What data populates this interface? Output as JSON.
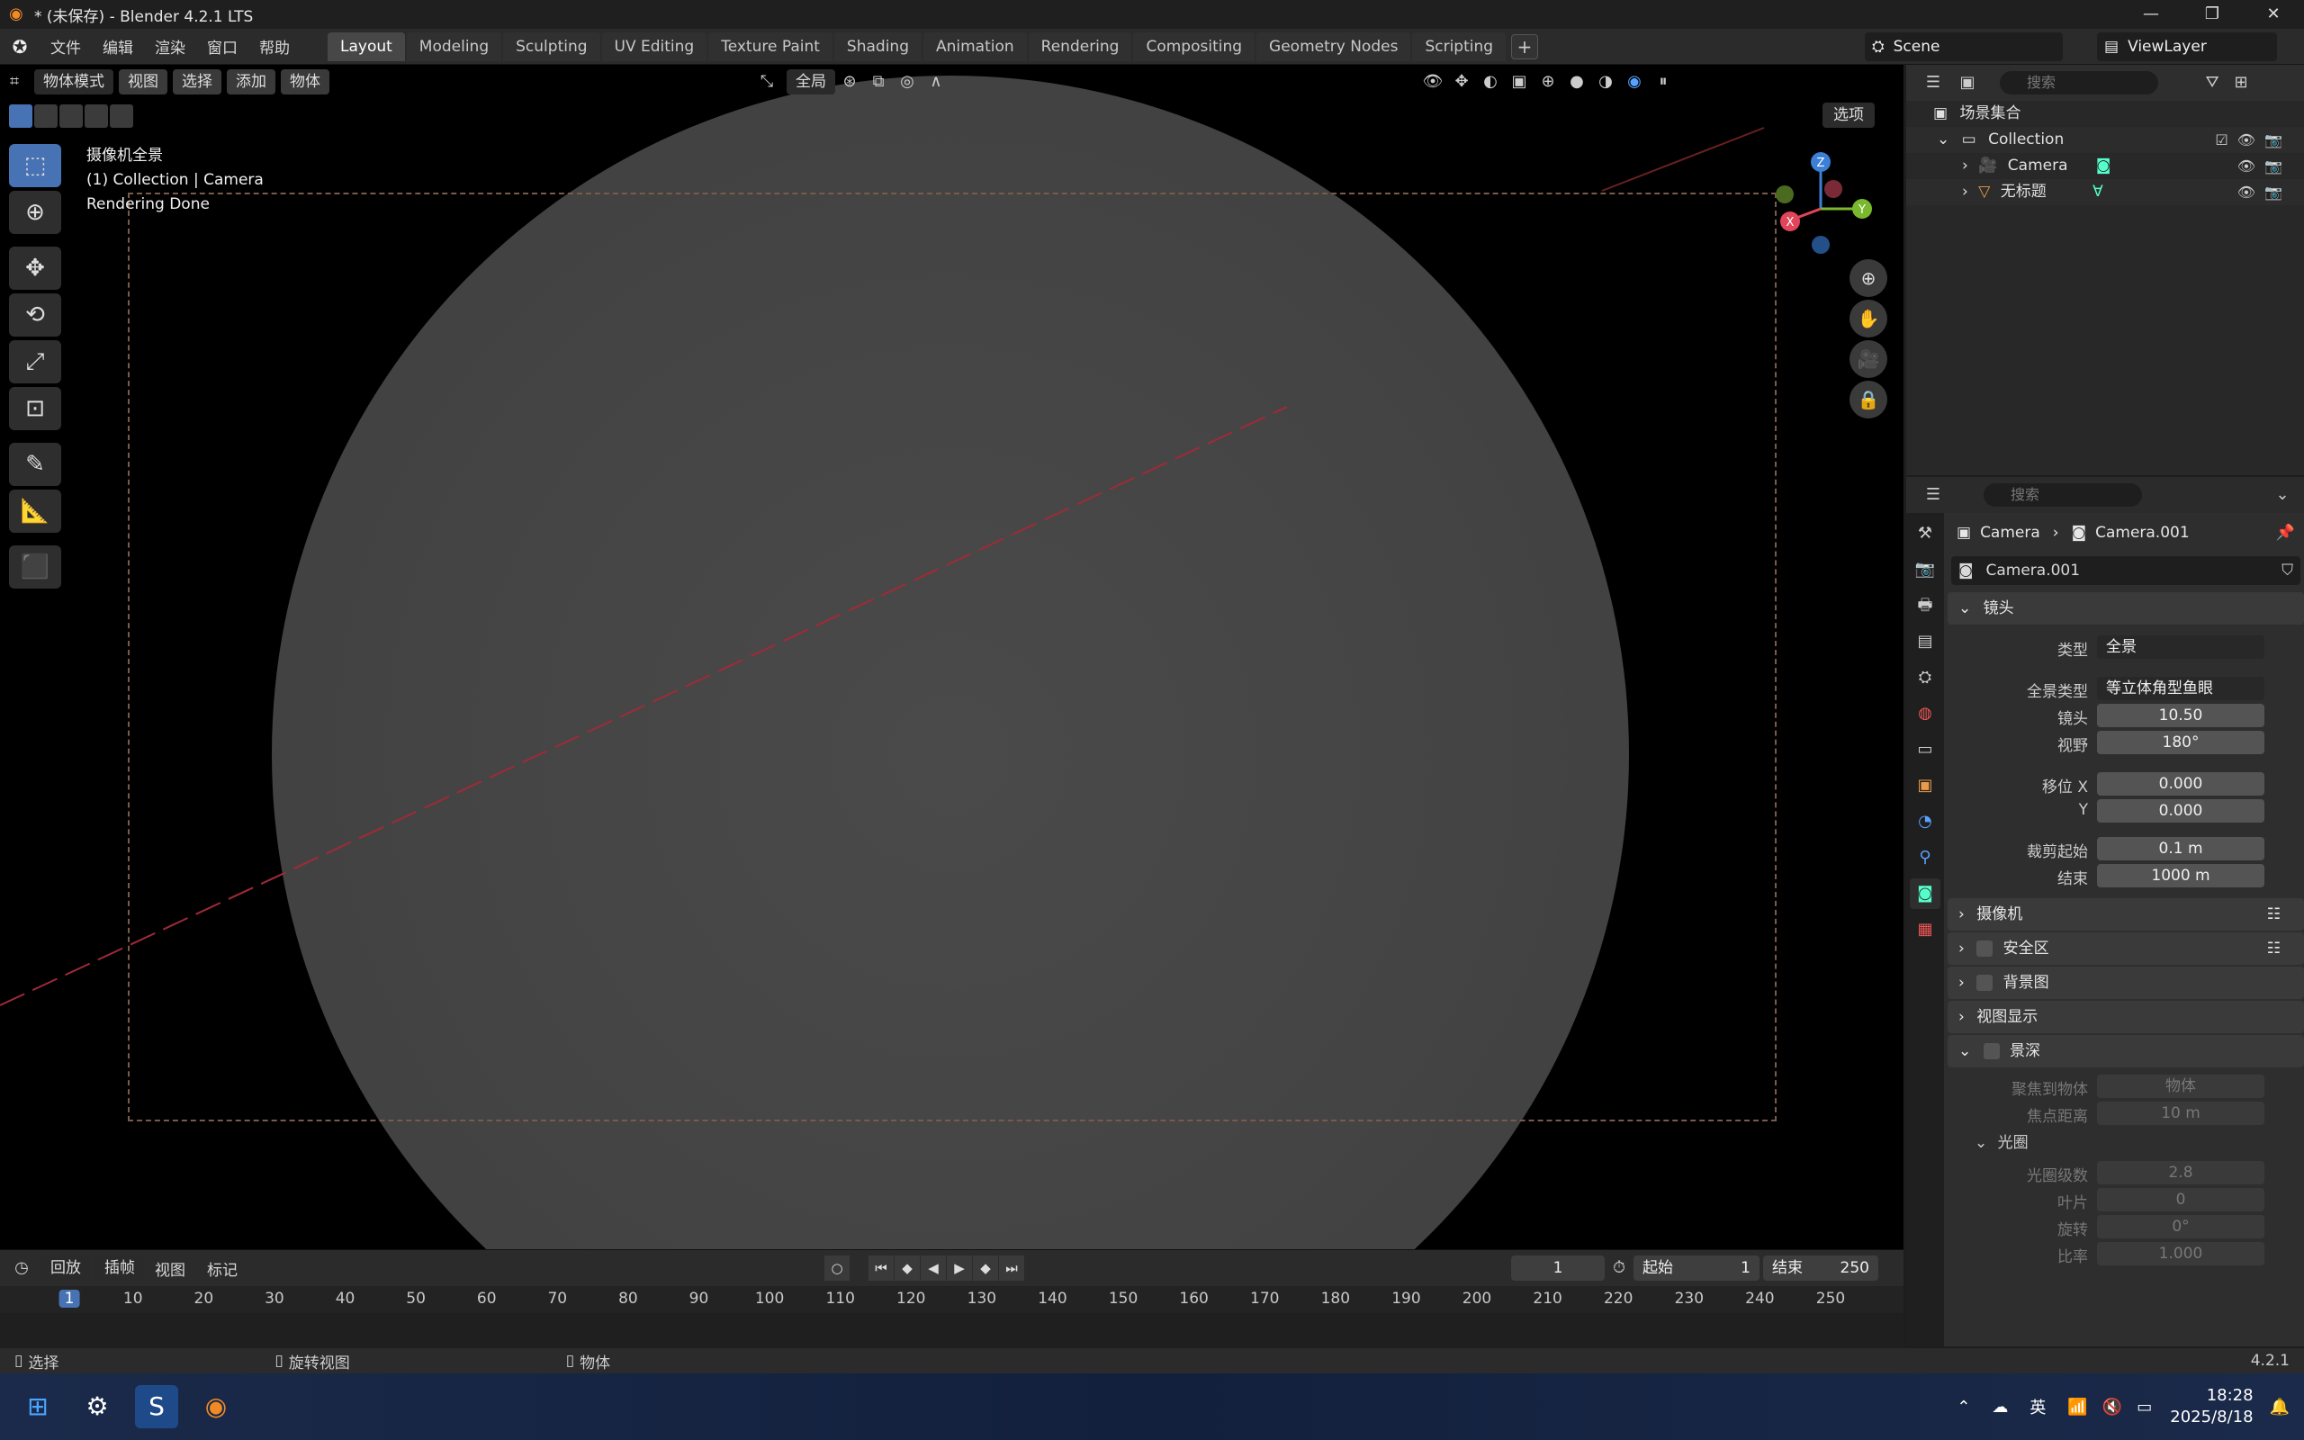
{
  "window": {
    "title": "* (未保存) - Blender 4.2.1 LTS",
    "controls": [
      "—",
      "❐",
      "✕"
    ]
  },
  "menu": [
    "文件",
    "编辑",
    "渲染",
    "窗口",
    "帮助"
  ],
  "workspaces": [
    "Layout",
    "Modeling",
    "Sculpting",
    "UV Editing",
    "Texture Paint",
    "Shading",
    "Animation",
    "Rendering",
    "Compositing",
    "Geometry Nodes",
    "Scripting"
  ],
  "active_workspace": "Layout",
  "scene": "Scene",
  "view_layer": "ViewLayer",
  "viewport": {
    "mode": "物体模式",
    "header_menus": [
      "视图",
      "选择",
      "添加",
      "物体"
    ],
    "transform_orientation": "全局",
    "options_label": "选项",
    "overlay_lines": [
      "摄像机全景",
      "(1) Collection | Camera",
      "Rendering Done"
    ],
    "gizmo_axes": {
      "x": "X",
      "y": "Y",
      "z": "Z"
    }
  },
  "outliner": {
    "search_placeholder": "搜索",
    "root": "场景集合",
    "collection": "Collection",
    "items": [
      "Camera",
      "无标题"
    ]
  },
  "properties": {
    "search_placeholder": "搜索",
    "breadcrumb": [
      "Camera",
      "Camera.001"
    ],
    "datablock": "Camera.001",
    "lens_section": "镜头",
    "type_label": "类型",
    "type_value": "全景",
    "pano_type_label": "全景类型",
    "pano_type_value": "等立体角型鱼眼",
    "lens_label": "镜头",
    "lens_value": "10.50",
    "fov_label": "视野",
    "fov_value": "180°",
    "shift_x_label": "移位 X",
    "shift_x_value": "0.000",
    "shift_y_label": "Y",
    "shift_y_value": "0.000",
    "clip_start_label": "裁剪起始",
    "clip_start_value": "0.1 m",
    "clip_end_label": "结束",
    "clip_end_value": "1000 m",
    "sections": [
      "摄像机",
      "安全区",
      "背景图",
      "视图显示"
    ],
    "dof_section": "景深",
    "focus_object_label": "聚焦到物体",
    "focus_object_value": "物体",
    "focus_distance_label": "焦点距离",
    "focus_distance_value": "10 m",
    "aperture_section": "光圈",
    "fstop_label": "光圈级数",
    "fstop_value": "2.8",
    "blades_label": "叶片",
    "blades_value": "0",
    "rotation_label": "旋转",
    "rotation_value": "0°",
    "ratio_label": "比率",
    "ratio_value": "1.000"
  },
  "timeline": {
    "menus": [
      "回放",
      "插帧",
      "视图",
      "标记"
    ],
    "current_frame": "1",
    "start_label": "起始",
    "start_value": "1",
    "end_label": "结束",
    "end_value": "250",
    "ticks": [
      "1",
      "10",
      "20",
      "30",
      "40",
      "50",
      "60",
      "70",
      "80",
      "90",
      "100",
      "110",
      "120",
      "130",
      "140",
      "150",
      "160",
      "170",
      "180",
      "190",
      "200",
      "210",
      "220",
      "230",
      "240",
      "250"
    ]
  },
  "status": {
    "left": "选择",
    "middle": "旋转视图",
    "right_action": "物体",
    "version": "4.2.1"
  },
  "taskbar": {
    "ime": "英",
    "time": "18:28",
    "date": "2025/8/18"
  },
  "colors": {
    "accent": "#4772b3",
    "x_axis": "#e0455a",
    "y_axis": "#7ab82e",
    "z_axis": "#3b80d6"
  }
}
